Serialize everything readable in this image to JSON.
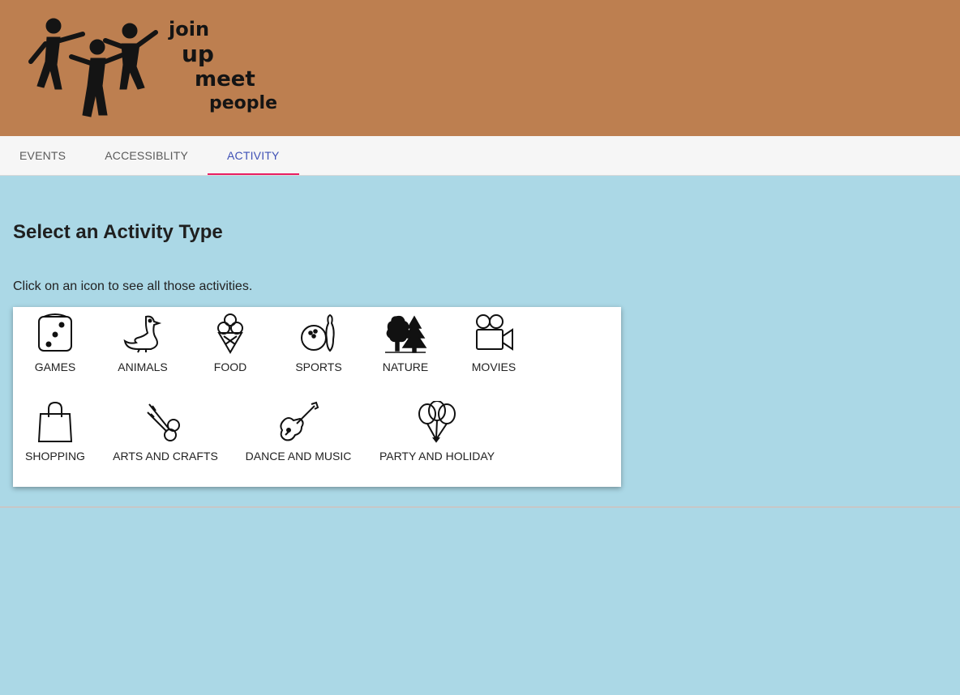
{
  "header": {
    "logo_words": [
      "join",
      "up",
      "meet",
      "people"
    ],
    "bg_color": "#bd7f50"
  },
  "tabs": [
    {
      "label": "EVENTS",
      "active": false
    },
    {
      "label": "ACCESSIBLITY",
      "active": false
    },
    {
      "label": "ACTIVITY",
      "active": true
    }
  ],
  "main": {
    "title": "Select an Activity Type",
    "instructions": "Click on an icon to see all those activities."
  },
  "activities": [
    {
      "label": "GAMES",
      "icon": "dice-icon"
    },
    {
      "label": "ANIMALS",
      "icon": "duck-icon"
    },
    {
      "label": "FOOD",
      "icon": "ice-cream-icon"
    },
    {
      "label": "SPORTS",
      "icon": "bowling-icon"
    },
    {
      "label": "NATURE",
      "icon": "trees-icon"
    },
    {
      "label": "MOVIES",
      "icon": "movie-camera-icon"
    },
    {
      "label": "SHOPPING",
      "icon": "shopping-bag-icon"
    },
    {
      "label": "ARTS AND CRAFTS",
      "icon": "scissors-icon"
    },
    {
      "label": "DANCE AND MUSIC",
      "icon": "guitar-icon"
    },
    {
      "label": "PARTY AND HOLIDAY",
      "icon": "balloons-icon"
    }
  ],
  "colors": {
    "page_bg": "#abd8e6",
    "tab_active": "#3f51b5",
    "tab_indicator": "#e91e63"
  }
}
